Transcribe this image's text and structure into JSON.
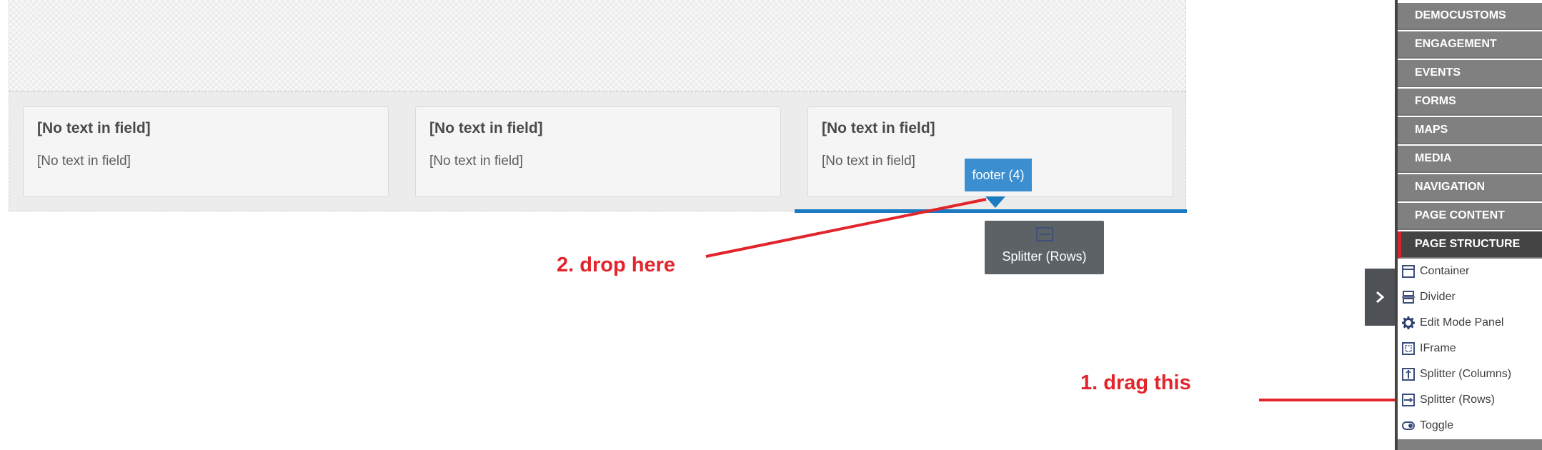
{
  "canvas": {
    "cards": [
      {
        "title": "[No text in field]",
        "body": "[No text in field]"
      },
      {
        "title": "[No text in field]",
        "body": "[No text in field]"
      },
      {
        "title": "[No text in field]",
        "body": "[No text in field]"
      }
    ],
    "footer_tag": "footer (4)",
    "drag_ghost_label": "Splitter (Rows)"
  },
  "annotations": {
    "drop": "2. drop here",
    "drag": "1. drag this",
    "color": "#e2242c"
  },
  "sidebar": {
    "categories": [
      "DEMOCUSTOMS",
      "ENGAGEMENT",
      "EVENTS",
      "FORMS",
      "MAPS",
      "MEDIA",
      "NAVIGATION",
      "PAGE CONTENT",
      "PAGE STRUCTURE"
    ],
    "active_category": "PAGE STRUCTURE",
    "tools": [
      {
        "label": "Container",
        "icon": "container-icon"
      },
      {
        "label": "Divider",
        "icon": "divider-icon"
      },
      {
        "label": "Edit Mode Panel",
        "icon": "gear-icon"
      },
      {
        "label": "IFrame",
        "icon": "iframe-icon"
      },
      {
        "label": "Splitter (Columns)",
        "icon": "splitter-columns-icon"
      },
      {
        "label": "Splitter (Rows)",
        "icon": "splitter-rows-icon"
      },
      {
        "label": "Toggle",
        "icon": "toggle-icon"
      }
    ]
  },
  "colors": {
    "accent_blue": "#3b8fd0",
    "drop_line": "#1c7bc0",
    "active_marker": "#d3262c"
  }
}
